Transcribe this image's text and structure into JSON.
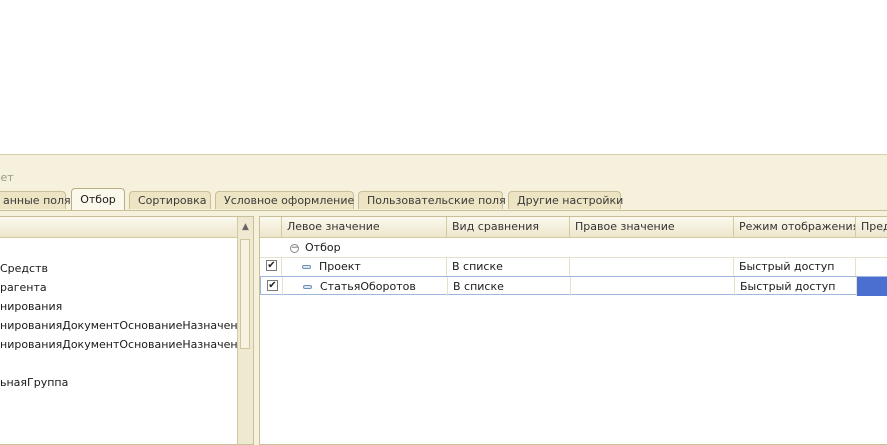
{
  "panel": {
    "caption": "чет"
  },
  "tabs": [
    {
      "label": "анные поля",
      "active": false
    },
    {
      "label": "Отбор",
      "active": true
    },
    {
      "label": "Сортировка",
      "active": false
    },
    {
      "label": "Условное оформление",
      "active": false
    },
    {
      "label": "Пользовательские поля",
      "active": false
    },
    {
      "label": "Другие настройки",
      "active": false
    }
  ],
  "fields": {
    "scroll_up_icon": "▲",
    "items": [
      "Средств",
      "рагента",
      "нирования",
      "нированияДокументОснованиеНазначениеПла",
      "нированияДокументОснованиеНазначениеПла",
      "",
      "ьнаяГруппа"
    ]
  },
  "filter_grid": {
    "columns": [
      "Левое значение",
      "Вид сравнения",
      "Правое значение",
      "Режим отображения",
      "Пред"
    ],
    "group": {
      "label": "Отбор",
      "icon": "collapse-icon"
    },
    "rows": [
      {
        "checked": true,
        "left": "Проект",
        "comparison": "В списке",
        "right": "",
        "mode": "Быстрый доступ"
      },
      {
        "checked": true,
        "left": "СтатьяОборотов",
        "comparison": "В списке",
        "right": "",
        "mode": "Быстрый доступ"
      }
    ],
    "checkmark": "✔"
  },
  "colors": {
    "panel_bg": "#f5f1dc",
    "selection": "#4a6fd1"
  }
}
